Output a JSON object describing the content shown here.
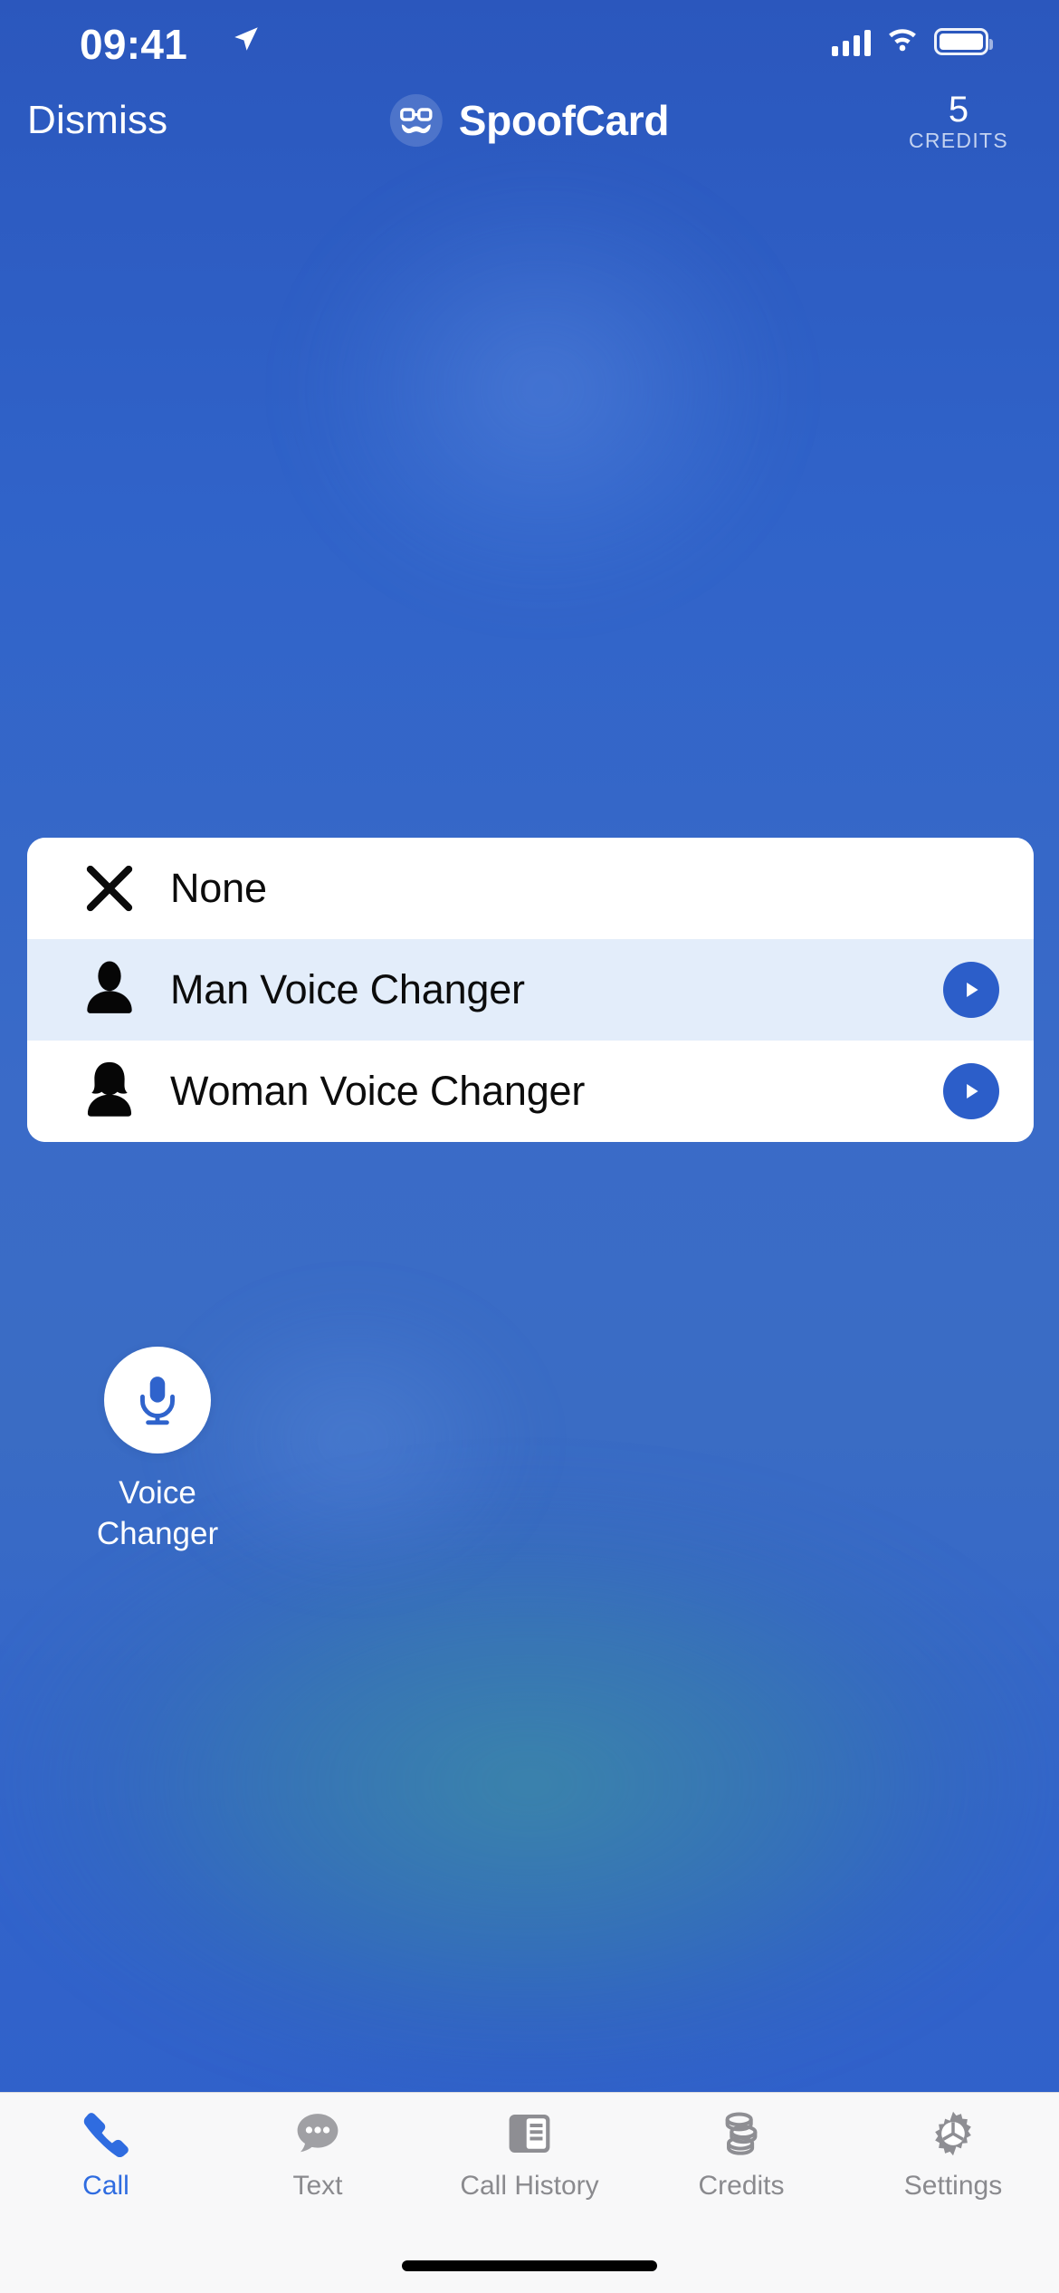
{
  "status_bar": {
    "time": "09:41",
    "location_icon": "location-arrow-icon",
    "signal_icon": "cellular-signal-icon",
    "wifi_icon": "wifi-icon",
    "battery_icon": "battery-full-icon"
  },
  "nav": {
    "dismiss_label": "Dismiss",
    "app_title": "SpoofCard",
    "logo_icon": "spoofcard-glasses-mustache-icon",
    "credits_value": "5",
    "credits_label": "CREDITS"
  },
  "voice_options": {
    "items": [
      {
        "label": "None",
        "icon": "close-x-icon",
        "selected": false,
        "has_play": false
      },
      {
        "label": "Man Voice Changer",
        "icon": "man-avatar-icon",
        "selected": true,
        "has_play": true
      },
      {
        "label": "Woman Voice Changer",
        "icon": "woman-avatar-icon",
        "selected": false,
        "has_play": true
      }
    ],
    "play_icon": "play-icon"
  },
  "voice_changer_tile": {
    "icon": "microphone-icon",
    "label_line1": "Voice",
    "label_line2": "Changer"
  },
  "tab_bar": {
    "tabs": [
      {
        "label": "Call",
        "icon": "phone-icon",
        "active": true
      },
      {
        "label": "Text",
        "icon": "chat-bubble-icon",
        "active": false
      },
      {
        "label": "Call History",
        "icon": "call-history-icon",
        "active": false
      },
      {
        "label": "Credits",
        "icon": "coins-icon",
        "active": false
      },
      {
        "label": "Settings",
        "icon": "gear-icon",
        "active": false
      }
    ]
  },
  "colors": {
    "background_blue": "#2f5fc9",
    "accent_blue": "#2c5ec9",
    "selected_row": "#e3edfa",
    "active_tab": "#2f6ce0",
    "inactive_tab": "#8a8a8e",
    "card_white": "#ffffff"
  }
}
